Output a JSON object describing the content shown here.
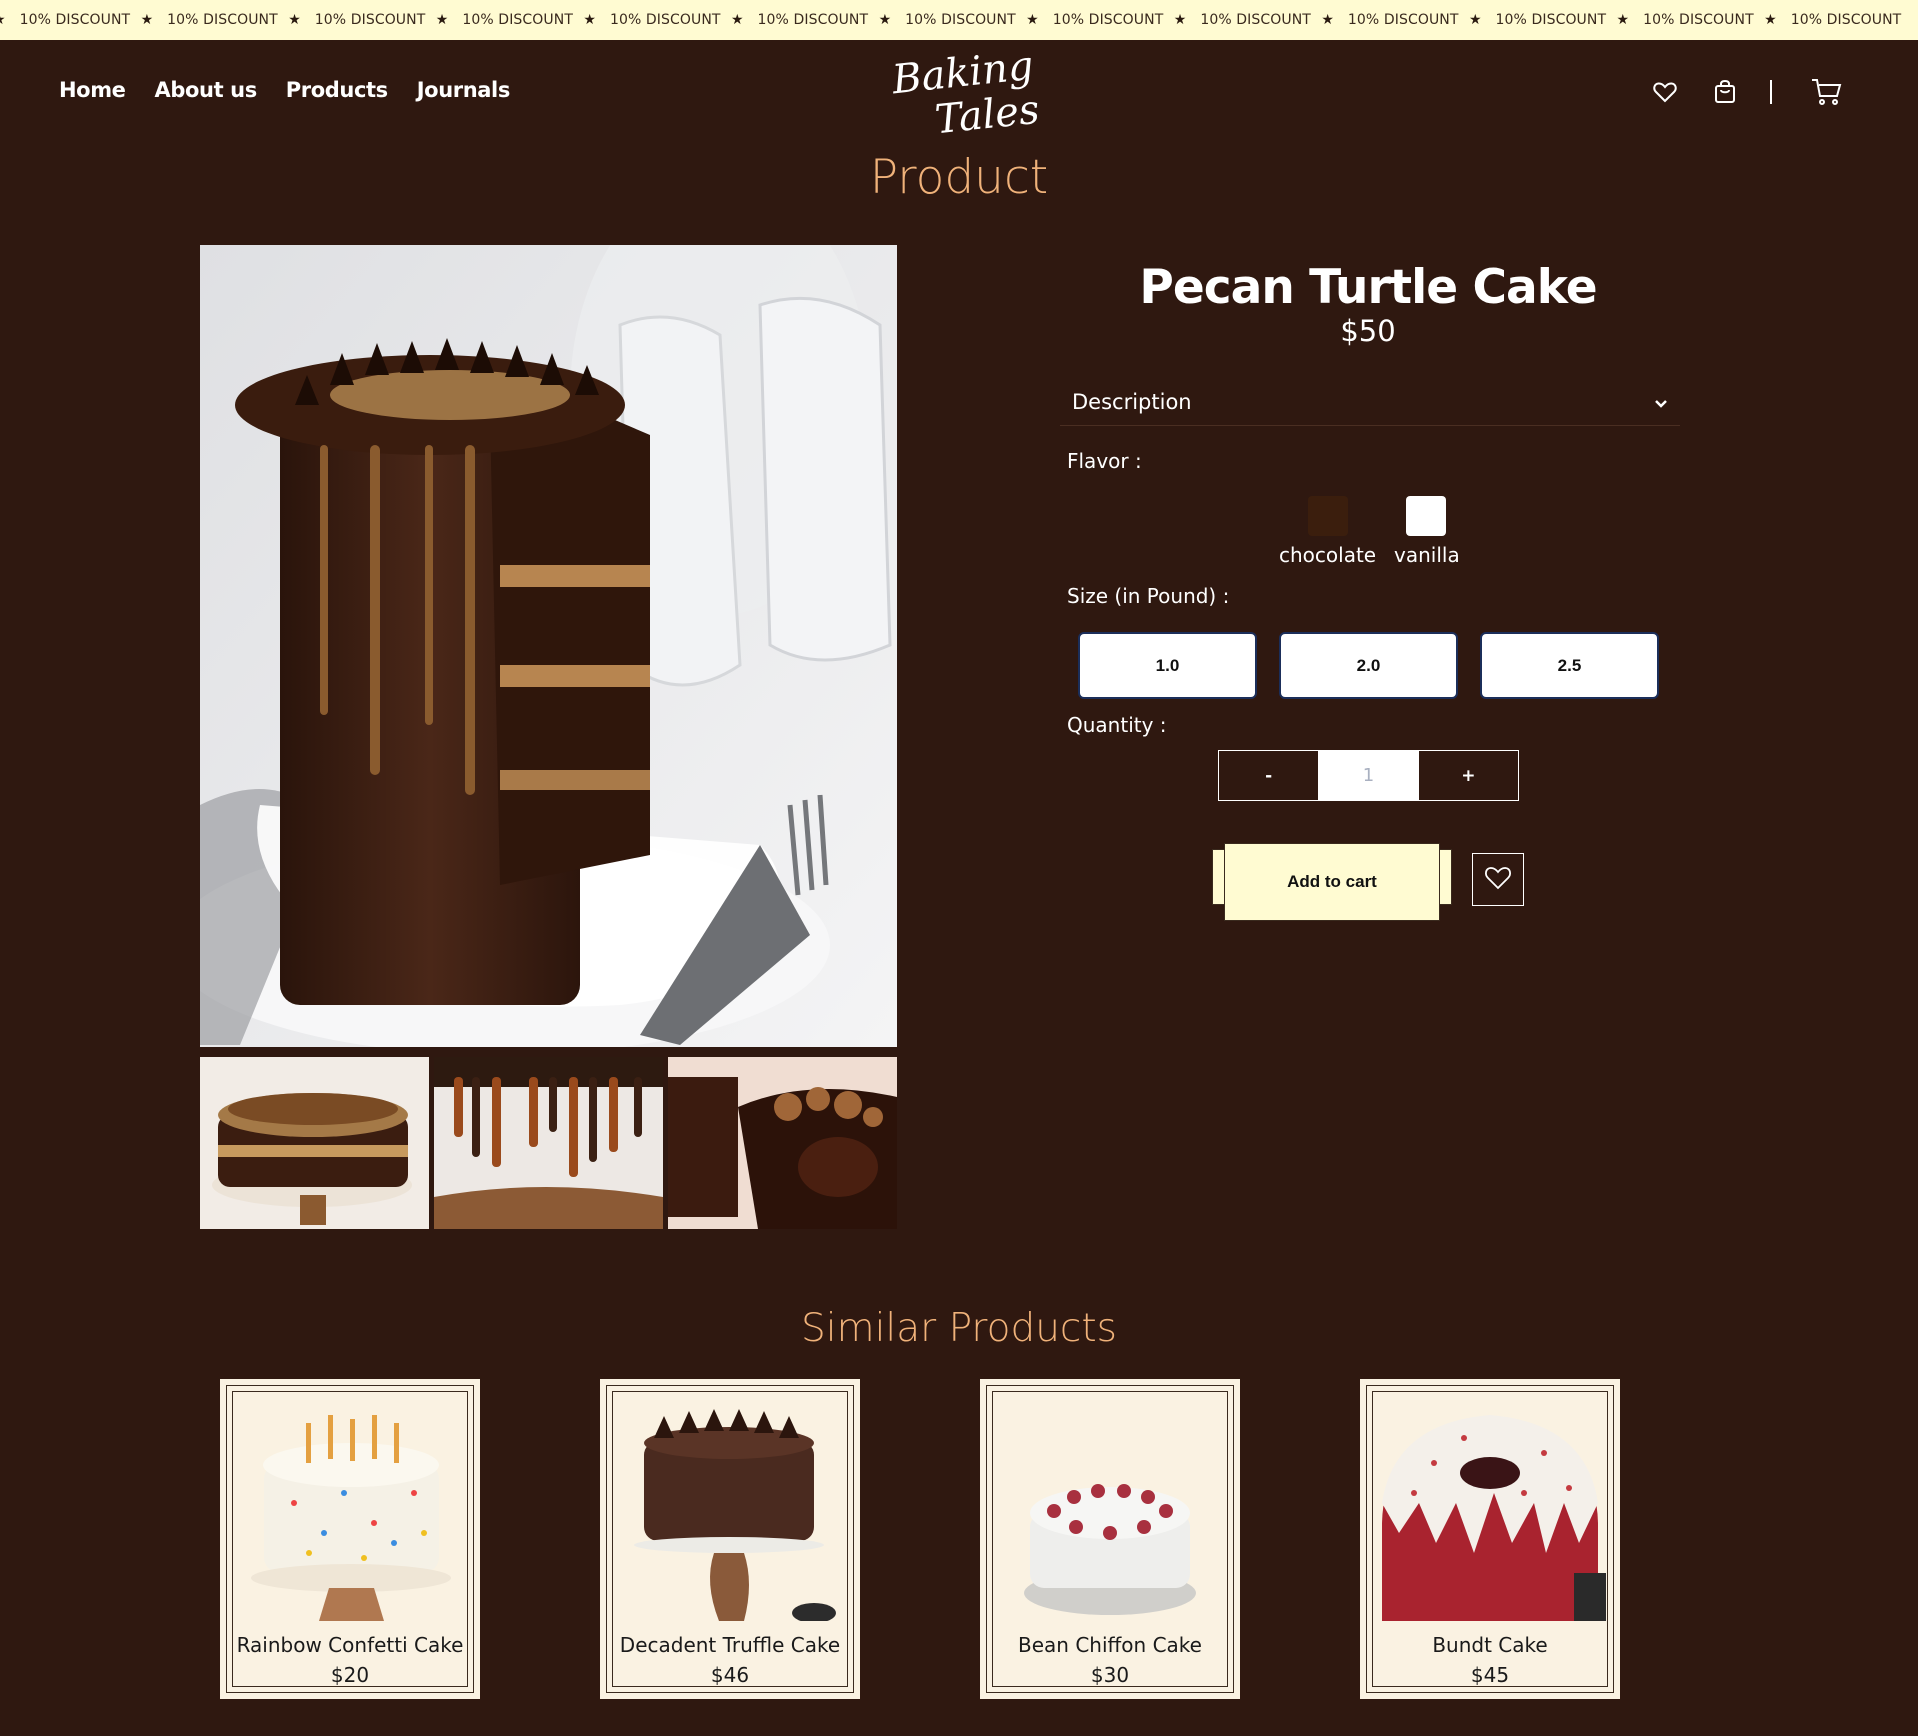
{
  "marquee": {
    "items": [
      "10% DISCOUNT",
      "10% DISCOUNT",
      "10% DISCOUNT",
      "10% DISCOUNT",
      "10% DISCOUNT",
      "10% DISCOUNT",
      "10% DISCOUNT",
      "10% DISCOUNT",
      "10% DISCOUNT",
      "10% DISCOUNT",
      "10% DISCOUNT",
      "10% DISCOUNT",
      "10% DISCOUNT"
    ]
  },
  "nav": {
    "home": "Home",
    "about": "About us",
    "products": "Products",
    "journals": "Journals"
  },
  "logo": {
    "line1": "Baking",
    "line2": "Tales"
  },
  "page": {
    "title": "Product"
  },
  "product": {
    "name": "Pecan Turtle Cake",
    "price": "$50",
    "description_label": "Description",
    "flavor_label": "Flavor :",
    "flavors": [
      {
        "label": "chocolate",
        "color": "#3b1e0d"
      },
      {
        "label": "vanilla",
        "color": "#ffffff"
      }
    ],
    "size_label": "Size (in Pound) :",
    "sizes": [
      "1.0",
      "2.0",
      "2.5"
    ],
    "quantity_label": "Quantity :",
    "quantity": {
      "minus": "-",
      "value": "1",
      "plus": "+"
    },
    "add_to_cart": "Add to cart"
  },
  "similar": {
    "title": "Similar Products",
    "items": [
      {
        "name": "Rainbow Confetti Cake",
        "price": "$20"
      },
      {
        "name": "Decadent Truffle Cake",
        "price": "$46"
      },
      {
        "name": "Bean Chiffon Cake",
        "price": "$30"
      },
      {
        "name": "Bundt Cake",
        "price": "$45"
      }
    ]
  },
  "colors": {
    "background": "#2f1810",
    "accent": "#f0b27a",
    "cream": "#fffbd2",
    "card": "#faf2e2"
  }
}
